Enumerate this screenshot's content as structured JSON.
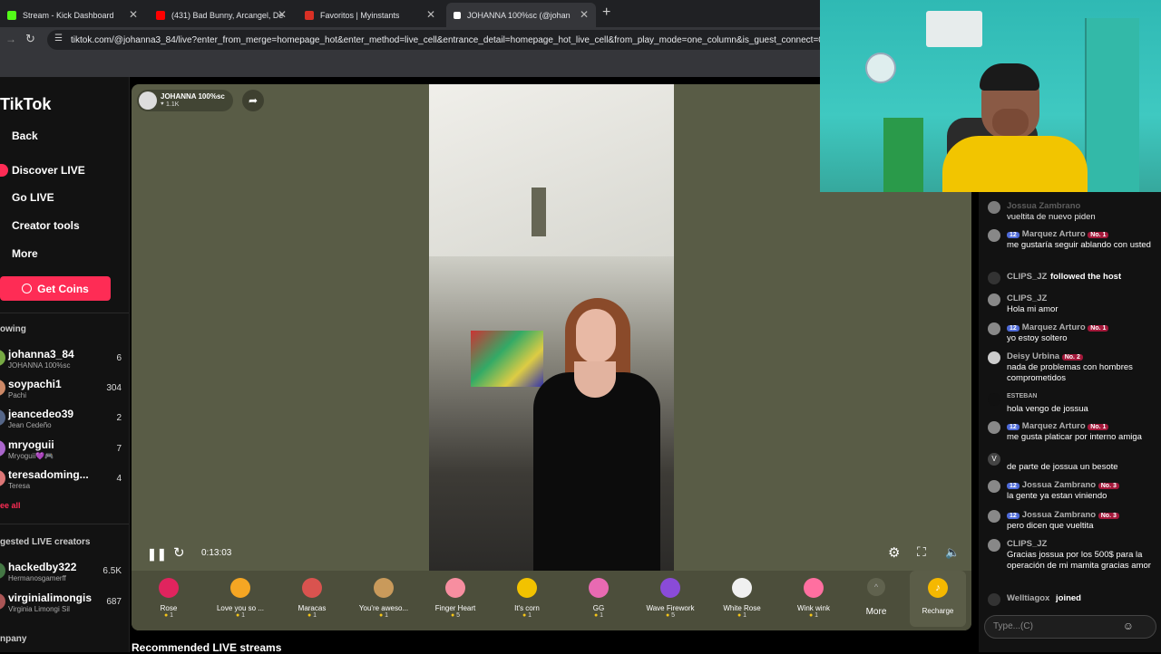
{
  "browser": {
    "tabs": [
      {
        "title": "Stream - Kick Dashboard",
        "color": "#53fc18"
      },
      {
        "title": "(431) Bad Bunny, Arcangel, De",
        "color": "#ff0000"
      },
      {
        "title": "Favoritos | Myinstants",
        "color": "#d93025"
      },
      {
        "title": "JOHANNA 100%sc (@johan",
        "color": "#ffffff"
      }
    ],
    "url": "tiktok.com/@johanna3_84/live?enter_from_merge=homepage_hot&enter_method=live_cell&entrance_detail=homepage_hot_live_cell&from_play_mode=one_column&is_guest_connect=0&is_"
  },
  "sidebar": {
    "logo": "TikTok",
    "nav": [
      {
        "label": "Back",
        "icon": "back-icon"
      },
      {
        "label": "Discover LIVE",
        "icon": "live-icon"
      },
      {
        "label": "Go LIVE",
        "icon": "camera-icon"
      },
      {
        "label": "Creator tools",
        "icon": "tools-icon"
      },
      {
        "label": "More",
        "icon": "more-icon"
      }
    ],
    "get_coins": "Get Coins",
    "following_label": "owing",
    "following": [
      {
        "name": "johanna3_84",
        "sub": "JOHANNA 100%sc",
        "count": "6"
      },
      {
        "name": "soypachi1",
        "sub": "Pachi",
        "count": "304"
      },
      {
        "name": "jeancedeo39",
        "sub": "Jean Cedeño",
        "count": "2"
      },
      {
        "name": "mryoguii",
        "sub": "Mryoguii💜🎮",
        "count": "7"
      },
      {
        "name": "teresadoming...",
        "sub": "Teresa",
        "count": "4"
      }
    ],
    "see_all": "ee all",
    "suggested_label": "gested LIVE creators",
    "suggested": [
      {
        "name": "hackedby322",
        "sub": "Hermanosgamerff",
        "count": "6.5K"
      },
      {
        "name": "virginialimongis",
        "sub": "Virginia Limongi Sil",
        "count": "687"
      }
    ],
    "company_label": "npany"
  },
  "player": {
    "host_name": "JOHANNA 100%sc",
    "host_likes": "1.1K",
    "time": "0:13:03",
    "gifts": [
      {
        "name": "Rose",
        "price": "1",
        "color": "#e0245e"
      },
      {
        "name": "Love you so ...",
        "price": "1",
        "color": "#f5a623"
      },
      {
        "name": "Maracas",
        "price": "1",
        "color": "#d9534f"
      },
      {
        "name": "You're aweso...",
        "price": "1",
        "color": "#c99a5b"
      },
      {
        "name": "Finger Heart",
        "price": "5",
        "color": "#f78ea0"
      },
      {
        "name": "It's corn",
        "price": "1",
        "color": "#f2c200"
      },
      {
        "name": "GG",
        "price": "1",
        "color": "#e86ab2"
      },
      {
        "name": "Wave Firework",
        "price": "5",
        "color": "#8a4bd8"
      },
      {
        "name": "White Rose",
        "price": "1",
        "color": "#f0f0f0"
      },
      {
        "name": "Wink wink",
        "price": "1",
        "color": "#ff6fa0"
      }
    ],
    "more_label": "More",
    "recharge_label": "Recharge"
  },
  "chat": {
    "messages": [
      {
        "user": "Jossua Zambrano",
        "text": "vueltita de nuevo piden",
        "lvl": "",
        "no": ""
      },
      {
        "user": "Marquez Arturo",
        "text": "me gustaría seguir ablando con usted",
        "lvl": "12",
        "no": "No. 1"
      },
      {
        "user": "CLIPS_JZ",
        "text": "followed the host",
        "lvl": "",
        "no": ""
      },
      {
        "user": "CLIPS_JZ",
        "text": "Hola mi amor",
        "lvl": "",
        "no": ""
      },
      {
        "user": "Marquez Arturo",
        "text": "yo estoy soltero",
        "lvl": "12",
        "no": "No. 1"
      },
      {
        "user": "Deisy Urbina",
        "text": "nada de problemas con hombres comprometidos",
        "lvl": "",
        "no": "No. 2"
      },
      {
        "user": "ESTEBAN",
        "text": "hola vengo de jossua",
        "lvl": "",
        "no": ""
      },
      {
        "user": "Marquez Arturo",
        "text": "me gusta platicar por interno amiga",
        "lvl": "12",
        "no": "No. 1"
      },
      {
        "user": "V",
        "text": "de parte de jossua un besote",
        "lvl": "",
        "no": ""
      },
      {
        "user": "Jossua Zambrano",
        "text": "la gente ya estan viniendo",
        "lvl": "12",
        "no": "No. 3"
      },
      {
        "user": "Jossua Zambrano",
        "text": "pero dicen que vueltita",
        "lvl": "12",
        "no": "No. 3"
      },
      {
        "user": "CLIPS_JZ",
        "text": "Gracias jossua por los 500$ para la operación de mi mamita gracias amor",
        "lvl": "",
        "no": ""
      },
      {
        "user": "Welltiagox",
        "text": "joined",
        "lvl": "",
        "no": ""
      }
    ],
    "input_placeholder": "Type...(C)"
  },
  "recommended": "Recommended LIVE streams"
}
